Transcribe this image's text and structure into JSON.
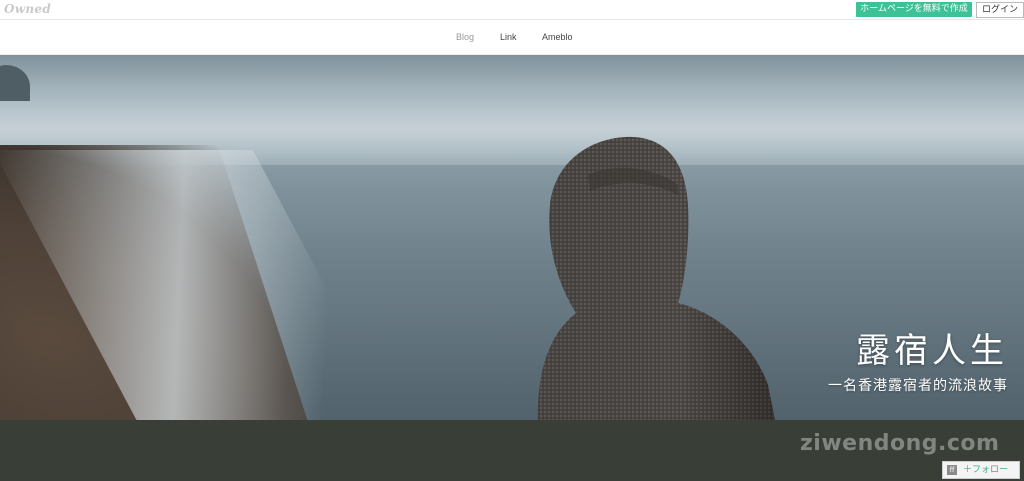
{
  "topbar": {
    "logo": "Owned",
    "cta_label": "ホームページを無料で作成",
    "login_label": "ログイン",
    "cta_color": "#3cc296"
  },
  "nav": {
    "items": [
      {
        "label": "Blog",
        "active": true
      },
      {
        "label": "Link",
        "active": false
      },
      {
        "label": "Ameblo",
        "active": false
      }
    ]
  },
  "hero": {
    "title": "露宿人生",
    "subtitle": "一名香港露宿者的流浪故事"
  },
  "footer": {
    "watermark": "ziwendong.com",
    "follow_icon": "ff",
    "follow_label": "＋フォロー",
    "band_color": "#393f37"
  }
}
